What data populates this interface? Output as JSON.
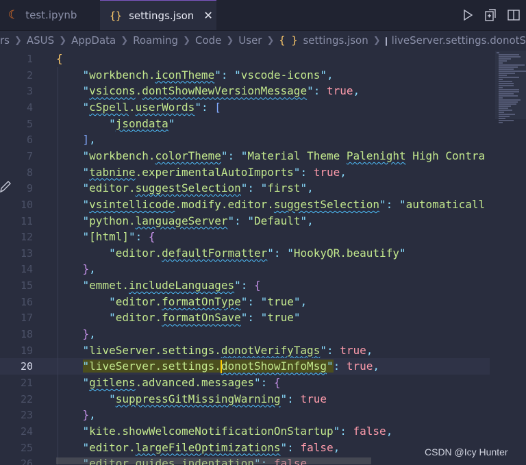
{
  "tabs": [
    {
      "label": "test.ipynb",
      "icon": "jupyter-icon",
      "active": false
    },
    {
      "label": "settings.json",
      "icon": "braces-icon",
      "active": true,
      "close": "✕"
    }
  ],
  "actions": [
    "run-icon",
    "open-changes-icon",
    "split-editor-icon"
  ],
  "breadcrumb": {
    "segments": [
      "rs",
      "ASUS",
      "AppData",
      "Roaming",
      "Code",
      "User"
    ],
    "file": "settings.json",
    "file_icon": "{ }",
    "symbol": "liveServer.settings.donotShowInfo"
  },
  "editor": {
    "current_line": 20,
    "lines": [
      {
        "n": 1,
        "text": "{"
      },
      {
        "n": 2,
        "text": "    \"workbench.iconTheme\": \"vscode-icons\","
      },
      {
        "n": 3,
        "text": "    \"vsicons.dontShowNewVersionMessage\": true,"
      },
      {
        "n": 4,
        "text": "    \"cSpell.userWords\": ["
      },
      {
        "n": 5,
        "text": "        \"jsondata\""
      },
      {
        "n": 6,
        "text": "    ],"
      },
      {
        "n": 7,
        "text": "    \"workbench.colorTheme\": \"Material Theme Palenight High Contras"
      },
      {
        "n": 8,
        "text": "    \"tabnine.experimentalAutoImports\": true,"
      },
      {
        "n": 9,
        "text": "    \"editor.suggestSelection\": \"first\","
      },
      {
        "n": 10,
        "text": "    \"vsintellicode.modify.editor.suggestSelection\": \"automatically"
      },
      {
        "n": 11,
        "text": "    \"python.languageServer\": \"Default\","
      },
      {
        "n": 12,
        "text": "    \"[html]\": {"
      },
      {
        "n": 13,
        "text": "        \"editor.defaultFormatter\": \"HookyQR.beautify\""
      },
      {
        "n": 14,
        "text": "    },"
      },
      {
        "n": 15,
        "text": "    \"emmet.includeLanguages\": {"
      },
      {
        "n": 16,
        "text": "        \"editor.formatOnType\": \"true\","
      },
      {
        "n": 17,
        "text": "        \"editor.formatOnSave\": \"true\""
      },
      {
        "n": 18,
        "text": "    },"
      },
      {
        "n": 19,
        "text": "    \"liveServer.settings.donotVerifyTags\": true,"
      },
      {
        "n": 20,
        "text": "    \"liveServer.settings.donotShowInfoMsg\": true,"
      },
      {
        "n": 21,
        "text": "    \"gitlens.advanced.messages\": {"
      },
      {
        "n": 22,
        "text": "        \"suppressGitMissingWarning\": true"
      },
      {
        "n": 23,
        "text": "    },"
      },
      {
        "n": 24,
        "text": "    \"kite.showWelcomeNotificationOnStartup\": false,"
      },
      {
        "n": 25,
        "text": "    \"editor.largeFileOptimizations\": false,"
      },
      {
        "n": 26,
        "text": "    \"editor.guides.indentation\": false"
      }
    ]
  },
  "watermark": "CSDN @Icy Hunter",
  "colors": {
    "background": "#292d3e",
    "string": "#c3e88d",
    "punctuation": "#89ddff",
    "keyword": "#ff9cac",
    "bracket": "#ffcb6b"
  }
}
